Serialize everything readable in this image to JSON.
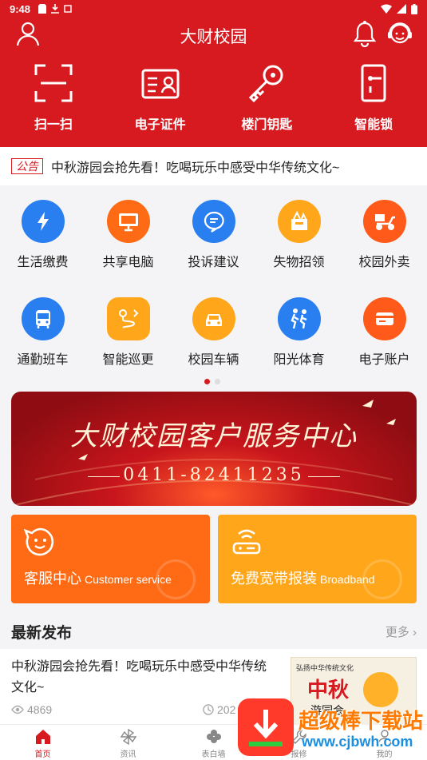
{
  "status_bar": {
    "time": "9:48"
  },
  "header": {
    "title": "大财校园",
    "quick_actions": [
      {
        "label": "扫一扫",
        "icon": "scan-icon"
      },
      {
        "label": "电子证件",
        "icon": "id-card-icon"
      },
      {
        "label": "楼门钥匙",
        "icon": "key-icon"
      },
      {
        "label": "智能锁",
        "icon": "smart-lock-icon"
      }
    ]
  },
  "notice": {
    "tag": "公告",
    "text": "中秋游园会抢先看！吃喝玩乐中感受中华传统文化~"
  },
  "grid": {
    "row1": [
      {
        "label": "生活缴费",
        "icon": "bolt-drop-icon",
        "color": "#2a7ff0"
      },
      {
        "label": "共享电脑",
        "icon": "monitor-icon",
        "color": "#ff6a14"
      },
      {
        "label": "投诉建议",
        "icon": "chat-icon",
        "color": "#2a7ff0"
      },
      {
        "label": "失物招领",
        "icon": "box-icon",
        "color": "#ffa61a"
      },
      {
        "label": "校园外卖",
        "icon": "scooter-icon",
        "color": "#ff5a1a"
      }
    ],
    "row2": [
      {
        "label": "通勤班车",
        "icon": "bus-icon",
        "color": "#2a7ff0"
      },
      {
        "label": "智能巡更",
        "icon": "route-icon",
        "color": "#ffa61a"
      },
      {
        "label": "校园车辆",
        "icon": "car-icon",
        "color": "#ffa61a"
      },
      {
        "label": "阳光体育",
        "icon": "runner-icon",
        "color": "#2a7ff0"
      },
      {
        "label": "电子账户",
        "icon": "card-icon",
        "color": "#ff5a1a"
      }
    ]
  },
  "banner": {
    "title": "大财校园客户服务中心",
    "phone": "0411-82411235"
  },
  "cards": {
    "customer_service": {
      "title": "客服中心",
      "subtitle": "Customer service"
    },
    "broadband": {
      "title": "免费宽带报装",
      "subtitle": "Broadband"
    }
  },
  "latest": {
    "heading": "最新发布",
    "more": "更多",
    "item": {
      "title": "中秋游园会抢先看！吃喝玩乐中感受中华传统文化~",
      "views": "4869",
      "date": "202",
      "thumb_caption": "弘扬中华传统文化",
      "thumb_big": "中秋",
      "thumb_sub": "游园会"
    }
  },
  "watermark": {
    "text": "超级棒下载站",
    "url": "www.cjbwh.com"
  },
  "tabbar": [
    {
      "label": "首页",
      "icon": "home-icon"
    },
    {
      "label": "资讯",
      "icon": "pinwheel-icon"
    },
    {
      "label": "表白墙",
      "icon": "clover-icon"
    },
    {
      "label": "报修",
      "icon": "wrench-icon"
    },
    {
      "label": "我的",
      "icon": "user-icon"
    }
  ]
}
